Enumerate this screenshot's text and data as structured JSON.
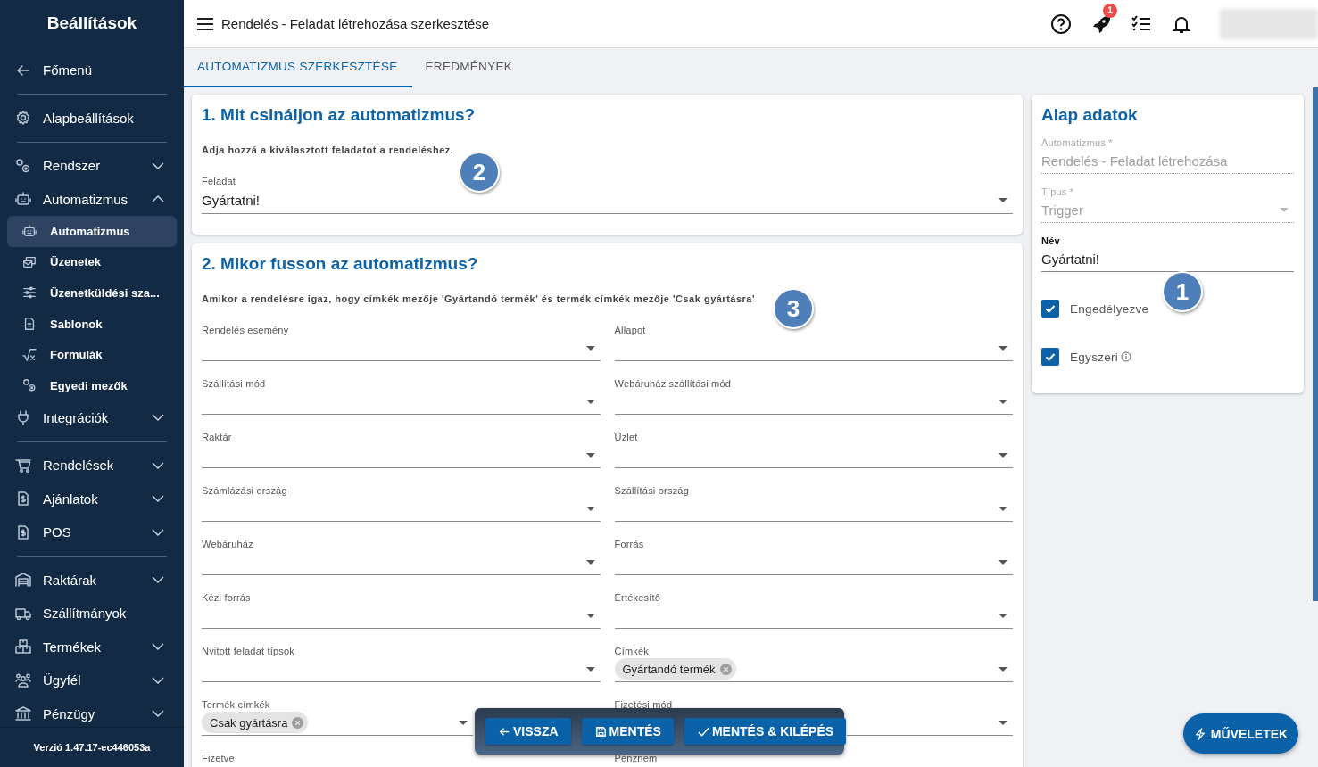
{
  "sidebar": {
    "title": "Beállítások",
    "items": [
      {
        "kind": "link",
        "label": "Főmenü"
      },
      {
        "kind": "divider"
      },
      {
        "kind": "link",
        "label": "Alapbeállítások"
      },
      {
        "kind": "divider"
      },
      {
        "kind": "group",
        "label": "Rendszer",
        "expanded": false
      },
      {
        "kind": "group",
        "label": "Automatizmus",
        "expanded": true,
        "children": [
          {
            "label": "Automatizmus",
            "selected": true
          },
          {
            "label": "Üzenetek",
            "selected": false
          },
          {
            "label": "Üzenetküldési sza...",
            "selected": false
          },
          {
            "label": "Sablonok",
            "selected": false
          },
          {
            "label": "Formulák",
            "selected": false
          },
          {
            "label": "Egyedi mezők",
            "selected": false
          }
        ]
      },
      {
        "kind": "group",
        "label": "Integrációk",
        "expanded": false
      },
      {
        "kind": "divider"
      },
      {
        "kind": "group",
        "label": "Rendelések",
        "expanded": false
      },
      {
        "kind": "group",
        "label": "Ajánlatok",
        "expanded": false
      },
      {
        "kind": "group",
        "label": "POS",
        "expanded": false
      },
      {
        "kind": "divider"
      },
      {
        "kind": "group",
        "label": "Raktárak",
        "expanded": false
      },
      {
        "kind": "link",
        "label": "Szállítmányok"
      },
      {
        "kind": "group",
        "label": "Termékek",
        "expanded": false
      },
      {
        "kind": "group",
        "label": "Ügyfél",
        "expanded": false
      },
      {
        "kind": "group",
        "label": "Pénzügy",
        "expanded": false
      }
    ],
    "version": "Verzió 1.47.17-ec446053a"
  },
  "topbar": {
    "title": "Rendelés - Feladat létrehozása szerkesztése",
    "notification_badge": "1"
  },
  "tabs": [
    {
      "label": "AUTOMATIZMUS SZERKESZTÉSE",
      "selected": true
    },
    {
      "label": "EREDMÉNYEK",
      "selected": false
    }
  ],
  "task_card": {
    "title": "1. Mit csináljon az automatizmus?",
    "description": "Adja hozzá a kiválasztott feladatot a rendeléshez.",
    "field": {
      "label": "Feladat",
      "value": "Gyártatni!"
    }
  },
  "condition_card": {
    "title": "2. Mikor fusson az automatizmus?",
    "description": "Amikor a rendelésre igaz, hogy címkék mezője 'Gyártandó termék' és termék címkék mezője 'Csak gyártásra'",
    "fields": [
      {
        "label": "Rendelés esemény"
      },
      {
        "label": "Állapot"
      },
      {
        "label": "Szállítási mód"
      },
      {
        "label": "Webáruház szállítási mód"
      },
      {
        "label": "Raktár"
      },
      {
        "label": "Üzlet"
      },
      {
        "label": "Számlázási ország"
      },
      {
        "label": "Szállítási ország"
      },
      {
        "label": "Webáruház"
      },
      {
        "label": "Forrás"
      },
      {
        "label": "Kézi forrás"
      },
      {
        "label": "Értékesítő"
      },
      {
        "label": "Nyitott feladat típsok"
      },
      {
        "label": "Címkék",
        "chips": [
          "Gyártandó termék"
        ]
      },
      {
        "label": "Termék címkék",
        "chips": [
          "Csak gyártásra"
        ]
      },
      {
        "label": "Fizetési mód"
      }
    ],
    "trailing_labels": [
      "Fizetve",
      "Pénznem"
    ]
  },
  "basic_card": {
    "title": "Alap adatok",
    "fields": [
      {
        "kind": "readonly",
        "label": "Automatizmus *",
        "value": "Rendelés - Feladat létrehozása"
      },
      {
        "kind": "readonly-select",
        "label": "Típus *",
        "value": "Trigger"
      },
      {
        "kind": "text",
        "label": "Név",
        "value": "Gyártatni!"
      }
    ],
    "checkboxes": [
      {
        "label": "Engedélyezve",
        "checked": true,
        "info": false
      },
      {
        "label": "Egyszeri",
        "checked": true,
        "info": true
      }
    ]
  },
  "markers": [
    "1",
    "2",
    "3"
  ],
  "action_bar": {
    "buttons": [
      {
        "kind": "back",
        "label": "VISSZA"
      },
      {
        "kind": "save",
        "label": "MENTÉS"
      },
      {
        "kind": "save-exit",
        "label": "MENTÉS & KILÉPÉS"
      }
    ]
  },
  "fab": {
    "label": "MŰVELETEK"
  }
}
